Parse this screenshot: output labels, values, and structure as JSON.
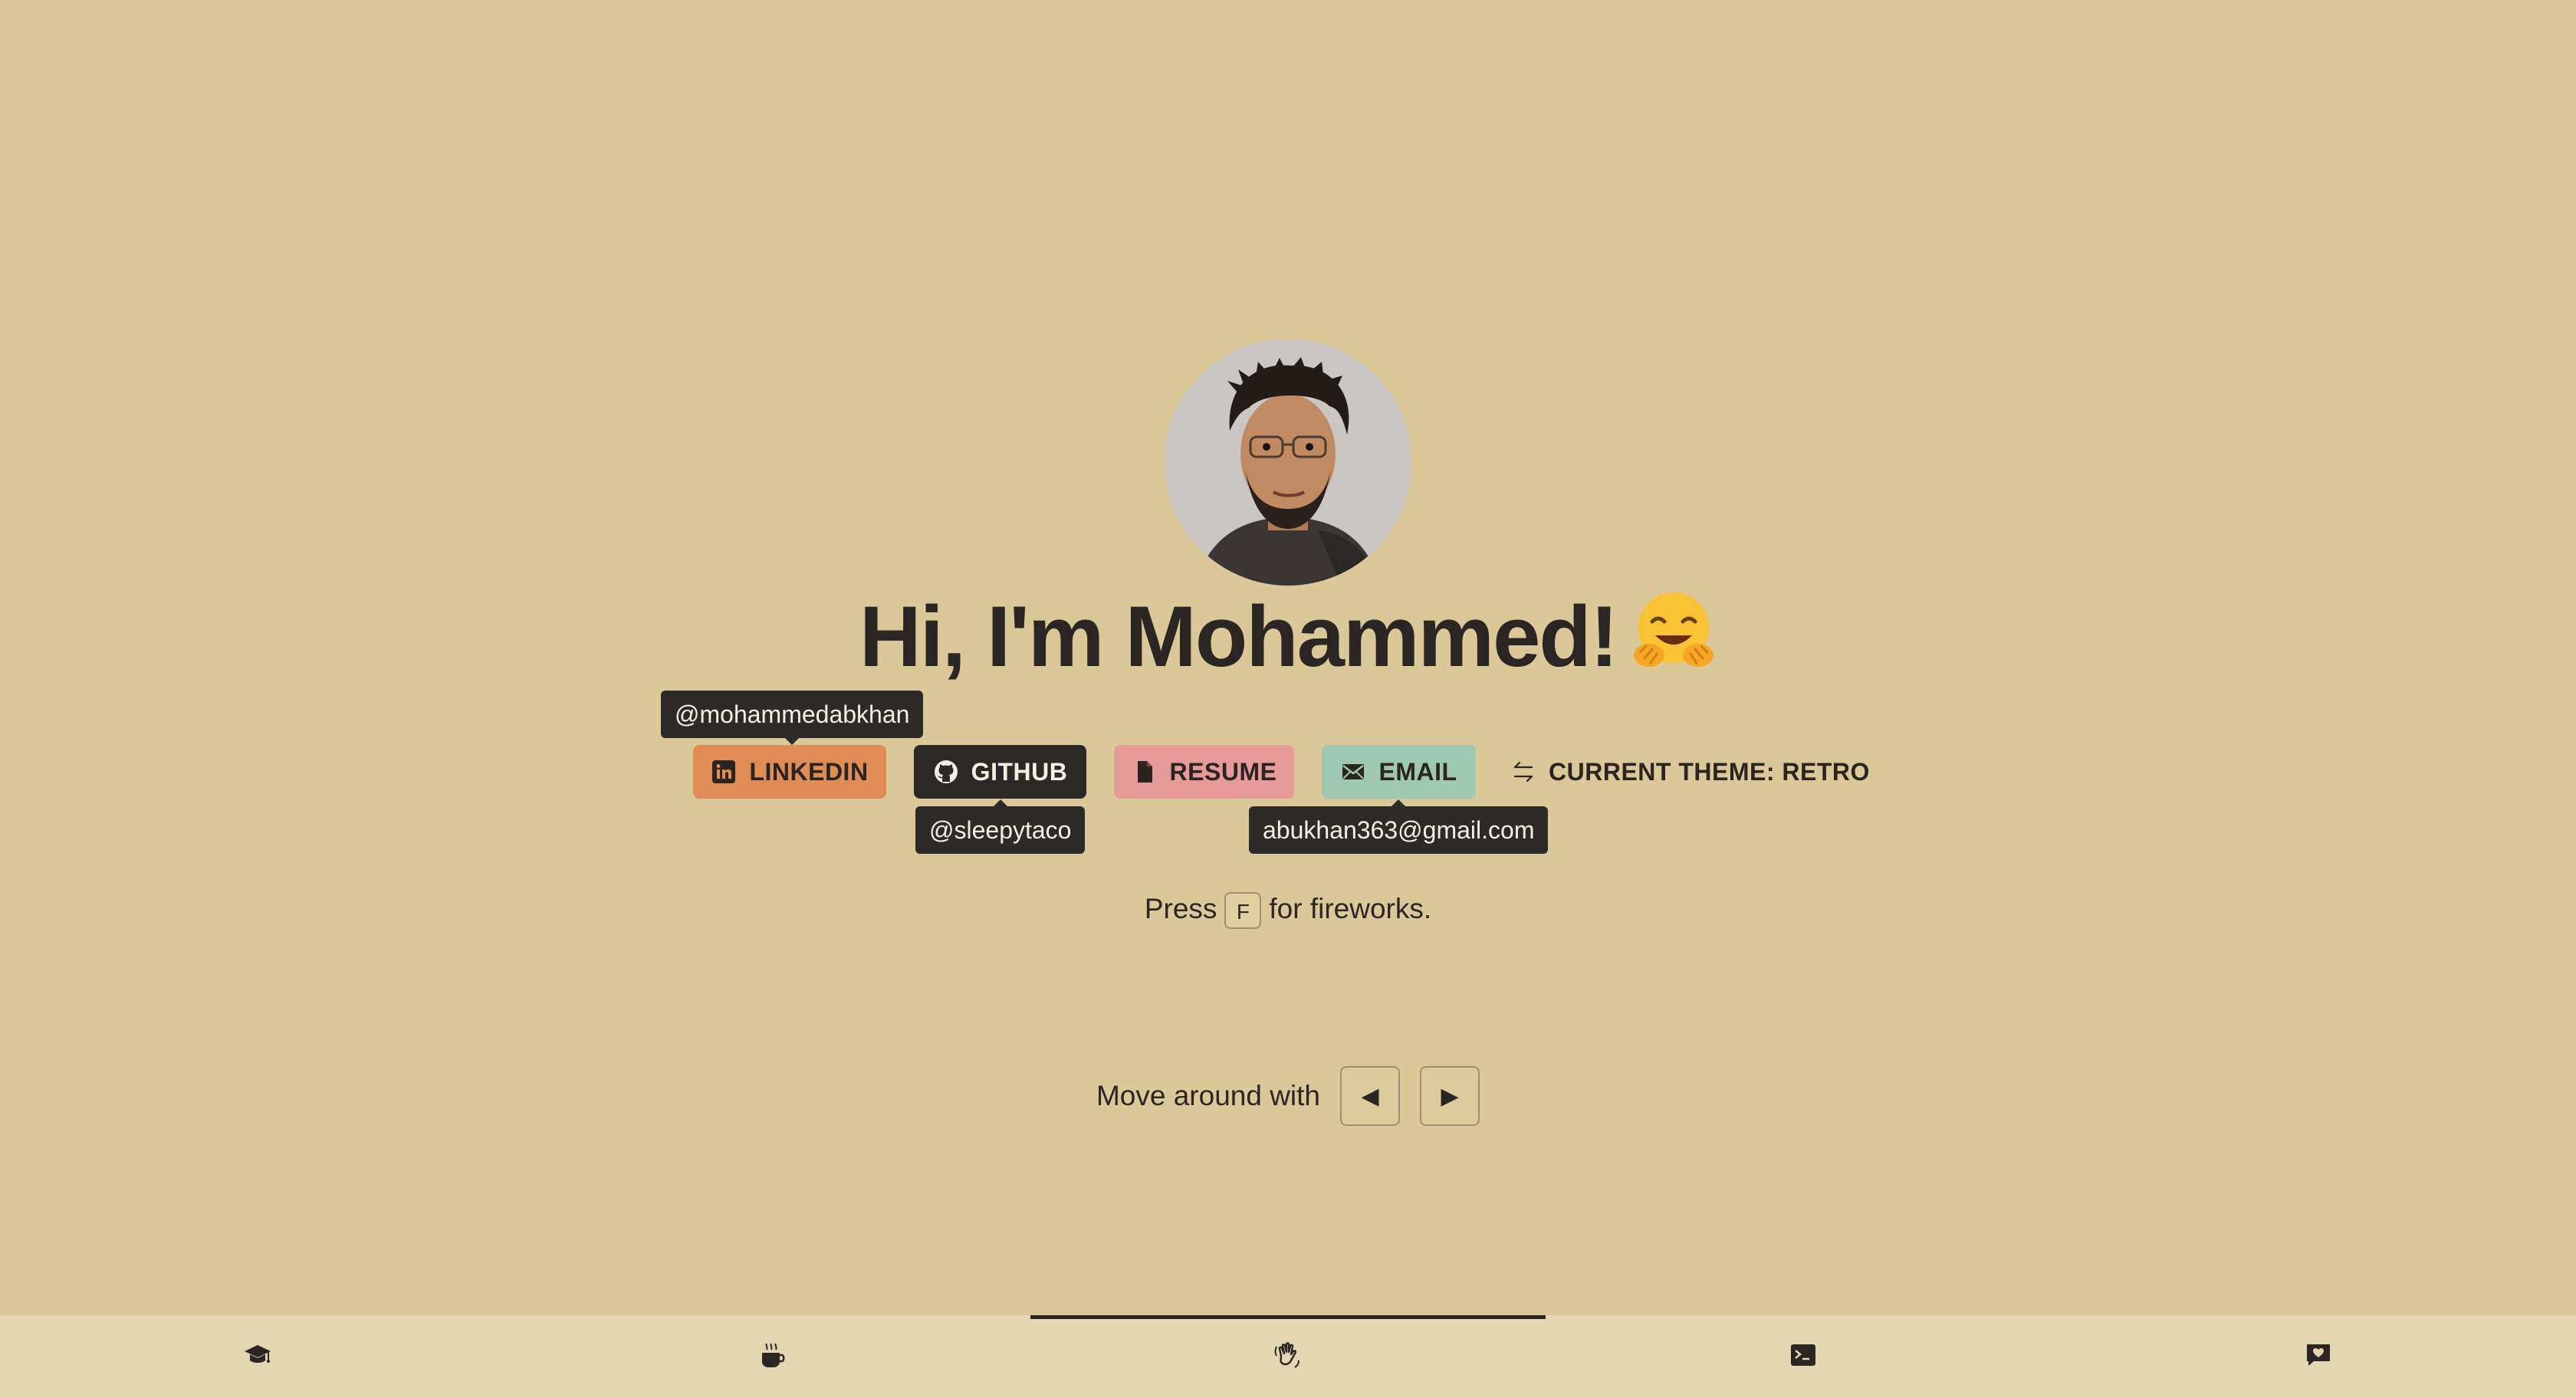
{
  "heading": {
    "text": "Hi, I'm Mohammed!",
    "emoji": "hugging-face-emoji"
  },
  "buttons": {
    "linkedin": {
      "label": "LINKEDIN",
      "icon": "linkedin-icon",
      "color": "#e08c55"
    },
    "github": {
      "label": "GITHUB",
      "icon": "github-icon",
      "color": "#2c2826"
    },
    "resume": {
      "label": "RESUME",
      "icon": "document-icon",
      "color": "#e79b98"
    },
    "email": {
      "label": "EMAIL",
      "icon": "mail-icon",
      "color": "#9ec8b2"
    },
    "theme": {
      "label": "CURRENT THEME: RETRO",
      "icon": "swap-arrows-icon"
    }
  },
  "tooltips": {
    "linkedin": "@mohammedabkhan",
    "github": "@sleepytaco",
    "email": "abukhan363@gmail.com"
  },
  "hints": {
    "fireworks_prefix": "Press",
    "fireworks_key": "F",
    "fireworks_suffix": "for fireworks.",
    "move_label": "Move around with",
    "left_key": "◀",
    "right_key": "▶"
  },
  "bottom_nav": {
    "items": [
      {
        "icon": "graduation-cap-icon"
      },
      {
        "icon": "coffee-cup-icon"
      },
      {
        "icon": "waving-hand-icon",
        "active": true
      },
      {
        "icon": "terminal-icon"
      },
      {
        "icon": "chat-heart-icon"
      }
    ]
  },
  "colors": {
    "background": "#dbc898",
    "nav_background": "#e3d6b1",
    "text": "#2b2624"
  }
}
